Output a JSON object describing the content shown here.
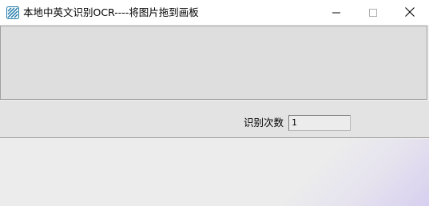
{
  "window": {
    "title": "本地中英文识别OCR----将图片拖到画板"
  },
  "controls": {
    "count_label": "识别次数",
    "count_value": "1"
  },
  "colors": {
    "icon_accent": "#1f7aa8",
    "canvas_bg": "#dedede"
  },
  "icons": {
    "app": "app-logo-icon",
    "minimize": "minimize-icon",
    "maximize": "maximize-icon",
    "close": "close-icon"
  }
}
